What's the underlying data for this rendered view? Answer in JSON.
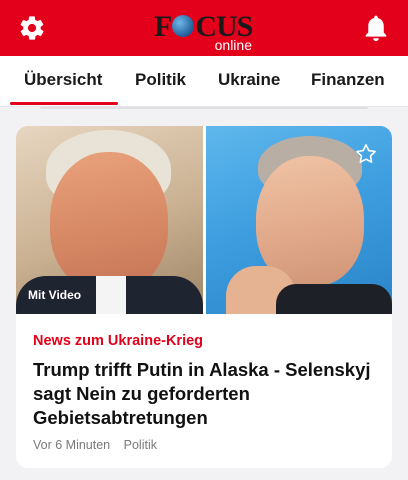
{
  "header": {
    "logo_main": "FOCUS",
    "logo_sub": "online",
    "left_icon": "gear-icon",
    "right_icon": "bell-icon",
    "brand_color": "#e2001a"
  },
  "tabs": [
    {
      "label": "Übersicht",
      "active": true
    },
    {
      "label": "Politik",
      "active": false
    },
    {
      "label": "Ukraine",
      "active": false
    },
    {
      "label": "Finanzen",
      "active": false
    }
  ],
  "article": {
    "video_label": "Mit Video",
    "bookmark_icon": "star-outline-icon",
    "kicker": "News zum Ukraine-Krieg",
    "headline": "Trump trifft Putin in Alaska - Selenskyj sagt Nein zu geforderten Gebietsabtretungen",
    "time": "Vor 6 Minuten",
    "section": "Politik"
  }
}
